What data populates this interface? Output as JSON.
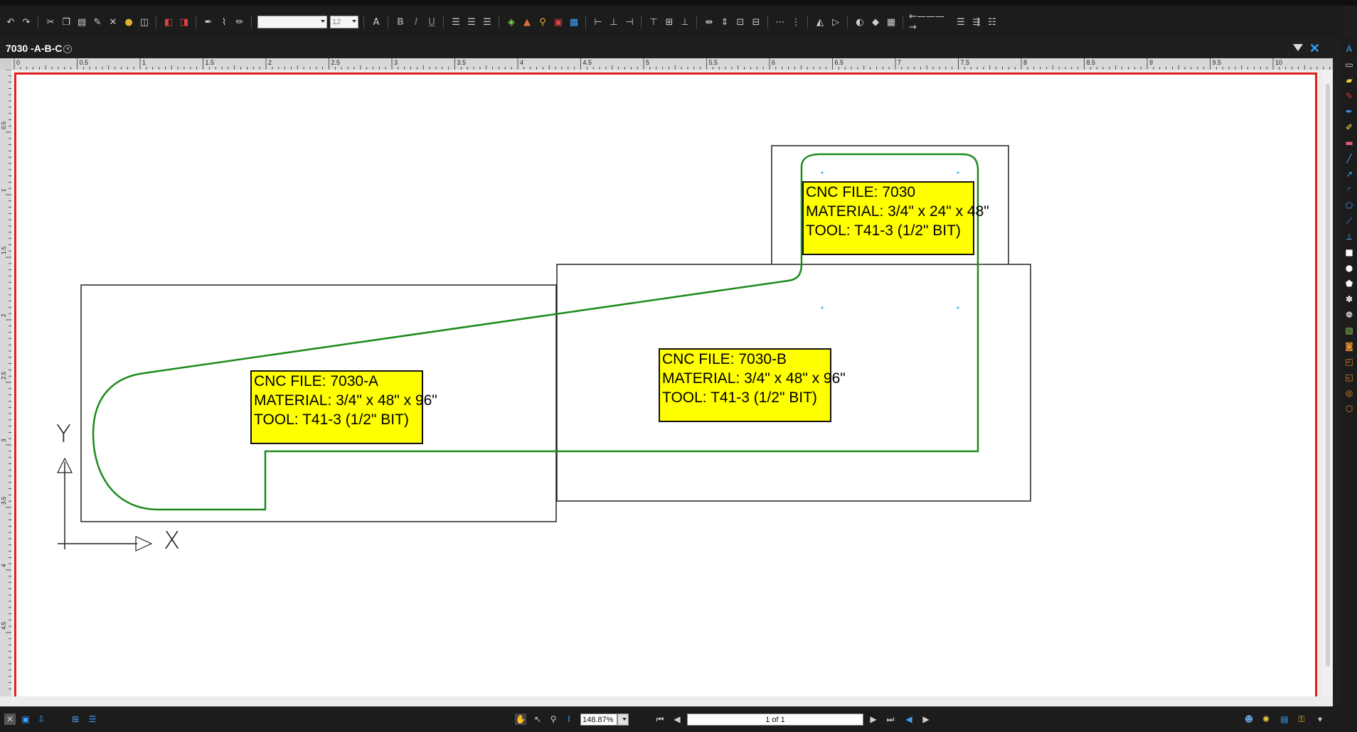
{
  "document": {
    "tab_title": "7030 -A-B-C"
  },
  "toolbar": {
    "font_name": "",
    "font_size": "12",
    "bold_label": "B",
    "italic_label": "I",
    "underline_label": "U",
    "text_color_label": "A"
  },
  "drawing": {
    "labels": [
      {
        "cnc_file": "CNC FILE: 7030",
        "material": "MATERIAL: 3/4\" x 24\" x 48\"",
        "tool": "TOOL: T41-3 (1/2\" BIT)"
      },
      {
        "cnc_file": "CNC FILE: 7030-A",
        "material": "MATERIAL: 3/4\" x 48\" x 96\"",
        "tool": "TOOL: T41-3 (1/2\" BIT)"
      },
      {
        "cnc_file": "CNC FILE: 7030-B",
        "material": "MATERIAL: 3/4\" x 48\" x 96\"",
        "tool": "TOOL: T41-3 (1/2\" BIT)"
      }
    ],
    "axis": {
      "x_label": "X",
      "y_label": "Y"
    },
    "colors": {
      "cut_path": "#1c8a1c",
      "label_fill": "#ffff00",
      "page_border": "#e02020"
    }
  },
  "rulers": {
    "horizontal": [
      "0",
      "0.5",
      "1",
      "1.5",
      "2",
      "2.5",
      "3",
      "3.5",
      "4",
      "4.5",
      "5",
      "5.5",
      "6",
      "6.5",
      "7",
      "7.5",
      "8",
      "8.5",
      "9",
      "9.5",
      "10"
    ],
    "vertical": [
      "0.5",
      "1",
      "1.5",
      "2",
      "2.5",
      "3",
      "3.5",
      "4",
      "4.5"
    ]
  },
  "statusbar": {
    "zoom": "148.87%",
    "page_indicator": "1 of 1"
  }
}
